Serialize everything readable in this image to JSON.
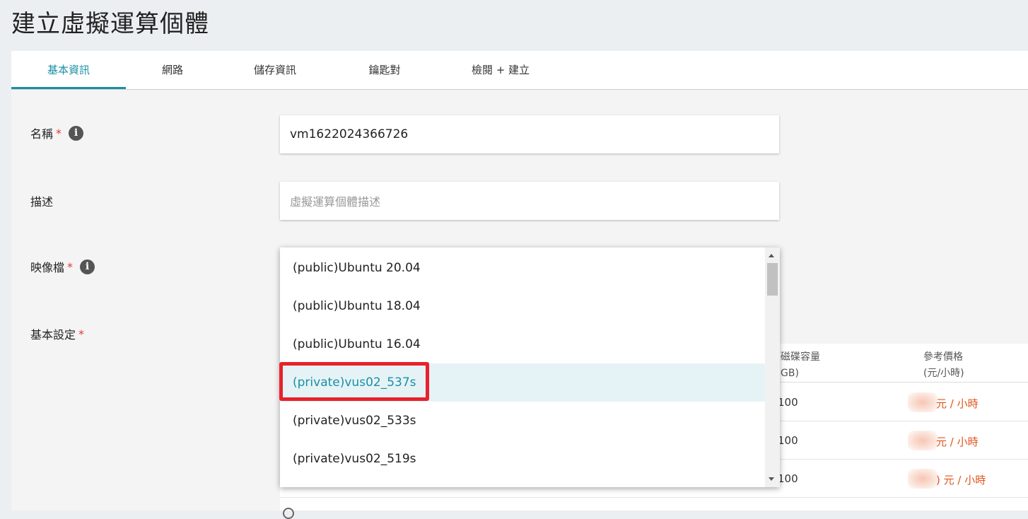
{
  "page_title": "建立虛擬運算個體",
  "tabs": [
    {
      "label": "基本資訊",
      "active": true
    },
    {
      "label": "網路"
    },
    {
      "label": "儲存資訊"
    },
    {
      "label": "鑰匙對"
    },
    {
      "label": "檢閱 + 建立"
    }
  ],
  "form": {
    "name_label": "名稱",
    "name_value": "vm1622024366726",
    "description_label": "描述",
    "description_placeholder": "虛擬運算個體描述",
    "image_label": "映像檔",
    "basic_settings_label": "基本設定",
    "required_mark": "*"
  },
  "image_dropdown": {
    "options": [
      "(public)Ubuntu 20.04",
      "(public)Ubuntu 18.04",
      "(public)Ubuntu 16.04",
      "(private)vus02_537s",
      "(private)vus02_533s",
      "(private)vus02_519s"
    ],
    "selected": "(private)vus02_537s"
  },
  "spec_table": {
    "headers": {
      "disk_line1": "磁碟容量",
      "disk_line2": "GB)",
      "price_line1": "參考價格",
      "price_line2": "(元/小時)"
    },
    "rows": [
      {
        "disk": "100",
        "price": "元 / 小時"
      },
      {
        "disk": "100",
        "price": "元 / 小時"
      },
      {
        "disk": "100",
        "price": ") 元 / 小時"
      }
    ]
  },
  "colors": {
    "accent": "#1a8fa6",
    "required": "#e53935",
    "price": "#e0541c",
    "highlight": "#e8212b"
  }
}
